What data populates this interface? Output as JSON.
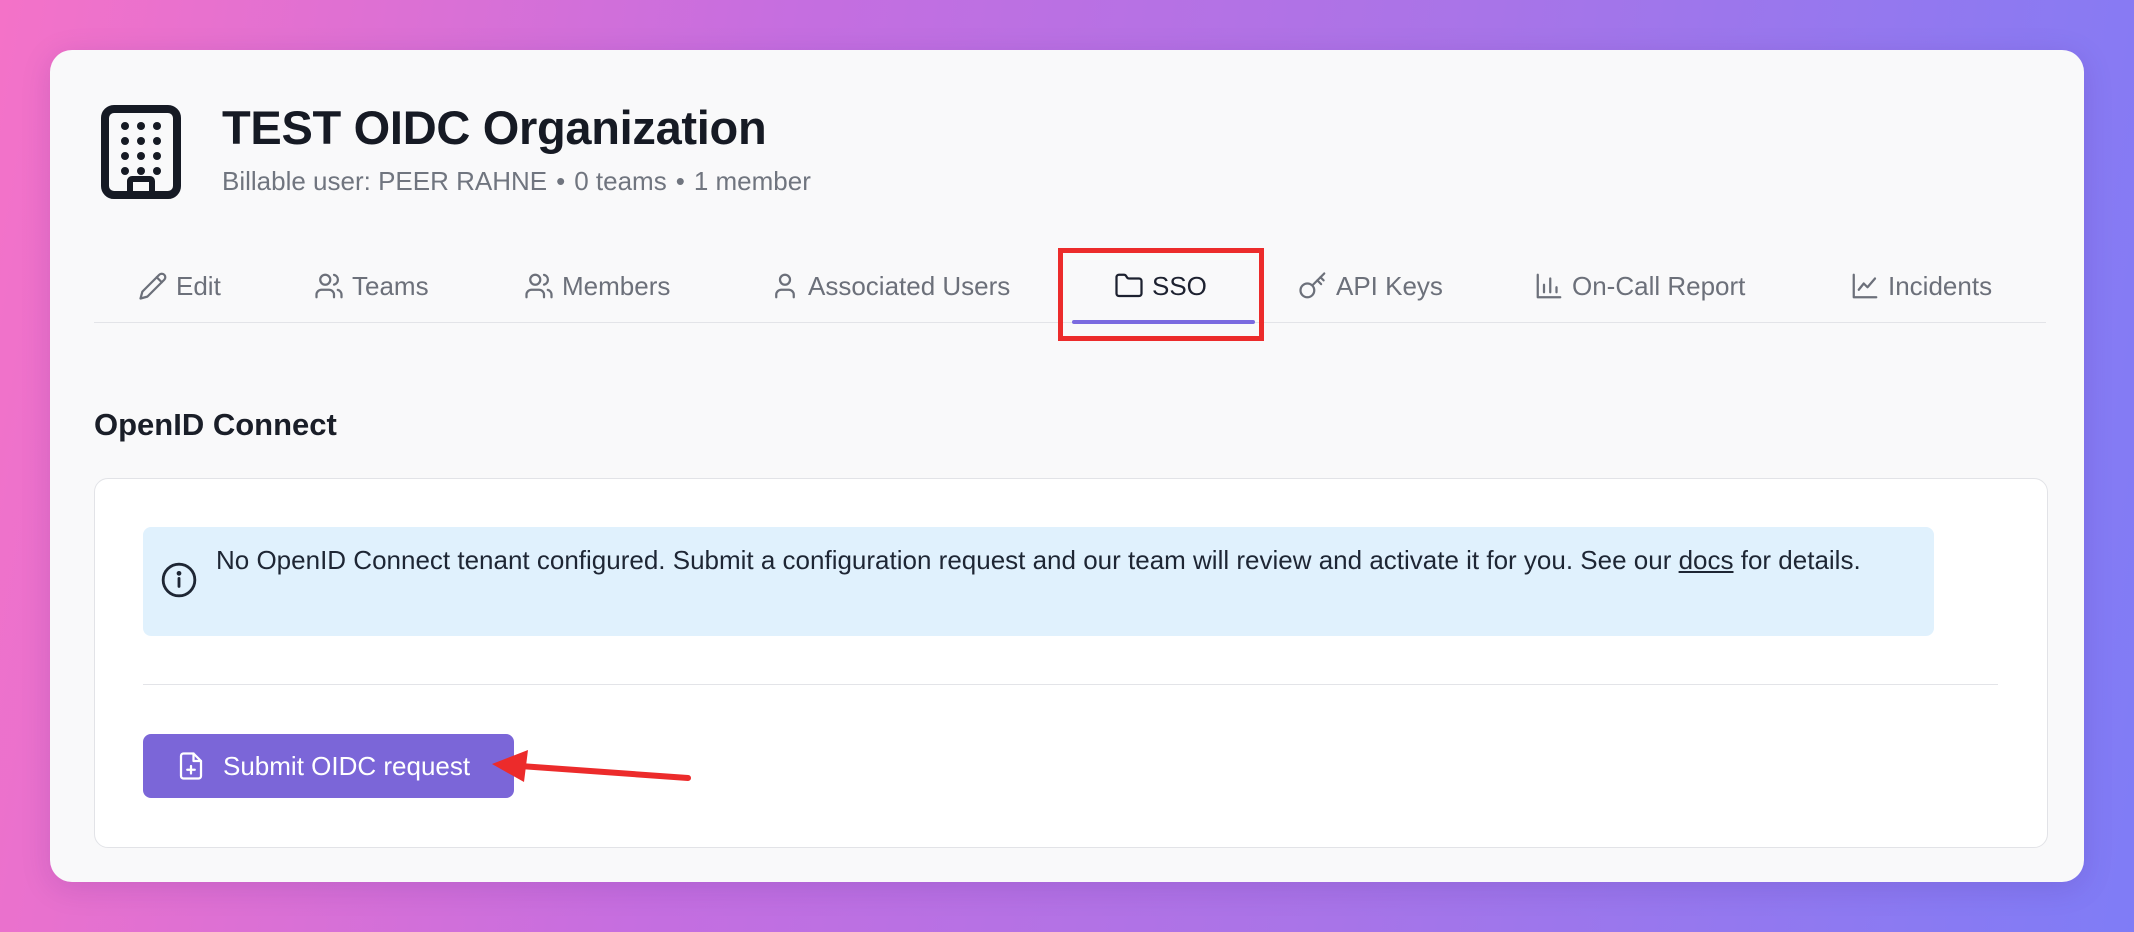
{
  "org": {
    "icon": "building-icon",
    "title": "TEST OIDC Organization",
    "billable": "Billable user: PEER RAHNE",
    "teams_count": "0 teams",
    "members_count": "1 member",
    "separator": "•"
  },
  "tabs": [
    {
      "label": "Edit",
      "icon": "pencil-icon"
    },
    {
      "label": "Teams",
      "icon": "users-icon"
    },
    {
      "label": "Members",
      "icon": "users-icon"
    },
    {
      "label": "Associated Users",
      "icon": "user-icon"
    },
    {
      "label": "SSO",
      "icon": "folder-icon",
      "active": true
    },
    {
      "label": "API Keys",
      "icon": "key-icon"
    },
    {
      "label": "On-Call Report",
      "icon": "bar-chart-icon"
    },
    {
      "label": "Incidents",
      "icon": "line-chart-icon"
    }
  ],
  "section": {
    "title": "OpenID Connect"
  },
  "alert": {
    "icon": "info-icon",
    "text_before": "No OpenID Connect tenant configured. Submit a configuration request and our team will review and activate it for you. See our ",
    "link": "docs",
    "text_after": " for details."
  },
  "submit": {
    "label": "Submit OIDC request",
    "icon": "file-plus-icon"
  },
  "colors": {
    "accent": "#7b66d8",
    "highlight": "#ec2b2b",
    "alert_bg": "#e0f1fd"
  }
}
